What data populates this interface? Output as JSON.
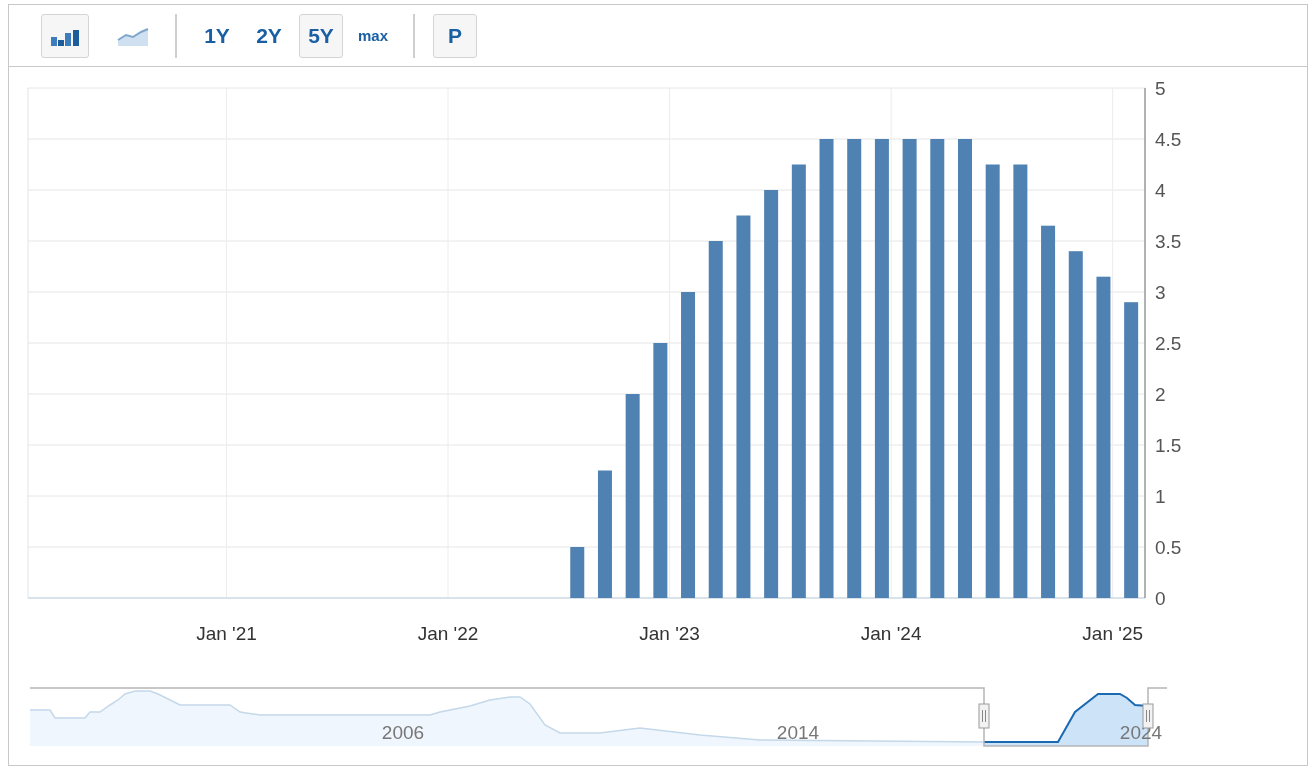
{
  "toolbar": {
    "chart_types": [
      {
        "kind": "bar",
        "selected": true
      },
      {
        "kind": "line",
        "selected": false
      }
    ],
    "ranges": [
      {
        "label": "1Y",
        "selected": false
      },
      {
        "label": "2Y",
        "selected": false
      },
      {
        "label": "5Y",
        "selected": true
      },
      {
        "label": "max",
        "selected": false
      }
    ],
    "print_button": {
      "label": "P"
    }
  },
  "chart": {
    "chart_data": {
      "type": "bar",
      "categories": [
        null,
        null,
        null,
        null,
        null,
        null,
        null,
        null,
        null,
        null,
        null,
        null,
        null,
        null,
        null,
        null,
        null,
        null,
        null,
        null,
        null,
        "Jan '21",
        null,
        null,
        null,
        null,
        null,
        null,
        null,
        null,
        null,
        null,
        null,
        null,
        null,
        null,
        null,
        null,
        null,
        null,
        null,
        null,
        null,
        null,
        null,
        "Jan '22",
        null,
        null,
        null,
        null,
        null,
        null,
        null,
        null,
        null,
        null,
        null,
        null,
        null,
        null,
        null,
        null,
        null,
        null,
        null,
        null,
        null,
        null,
        null,
        "Jan '23",
        null,
        null,
        null,
        null,
        null,
        null,
        null,
        null,
        null,
        null,
        null,
        null,
        null,
        null,
        null,
        null,
        null,
        null,
        null,
        null,
        null,
        null,
        null,
        "Jan '24",
        null,
        null,
        null,
        null,
        null,
        null,
        null,
        null,
        null,
        null,
        null,
        null,
        null,
        null,
        null,
        null,
        null,
        null,
        null,
        null,
        null,
        null,
        null,
        "Jan '25",
        null,
        null,
        null
      ],
      "series": [
        {
          "color": "#4f81b3",
          "values": [
            null,
            null,
            null,
            null,
            null,
            null,
            null,
            null,
            null,
            null,
            null,
            null,
            null,
            null,
            null,
            null,
            null,
            null,
            null,
            null,
            null,
            null,
            null,
            null,
            null,
            null,
            null,
            null,
            null,
            null,
            null,
            null,
            null,
            null,
            null,
            null,
            null,
            null,
            null,
            null,
            null,
            null,
            null,
            null,
            null,
            null,
            null,
            null,
            null,
            null,
            null,
            null,
            null,
            null,
            null,
            null,
            null,
            null,
            null,
            0.5,
            null,
            null,
            1.25,
            null,
            null,
            2,
            null,
            null,
            2.5,
            null,
            null,
            3,
            null,
            null,
            3.5,
            null,
            null,
            3.75,
            null,
            null,
            4,
            null,
            null,
            4.25,
            null,
            null,
            4.5,
            null,
            null,
            4.5,
            null,
            null,
            4.5,
            null,
            null,
            4.5,
            null,
            null,
            4.5,
            null,
            null,
            4.5,
            null,
            null,
            4.25,
            null,
            null,
            4.25,
            null,
            null,
            3.65,
            null,
            null,
            3.4,
            null,
            null,
            3.15,
            null,
            null,
            2.9,
            null
          ]
        }
      ],
      "ylim": [
        0,
        5
      ],
      "grid": true,
      "yticks": [
        0,
        0.5,
        1,
        1.5,
        2,
        2.5,
        3,
        3.5,
        4,
        4.5,
        5
      ]
    }
  },
  "navigator": {
    "labels": [
      "2006",
      "2014",
      "2024"
    ]
  }
}
